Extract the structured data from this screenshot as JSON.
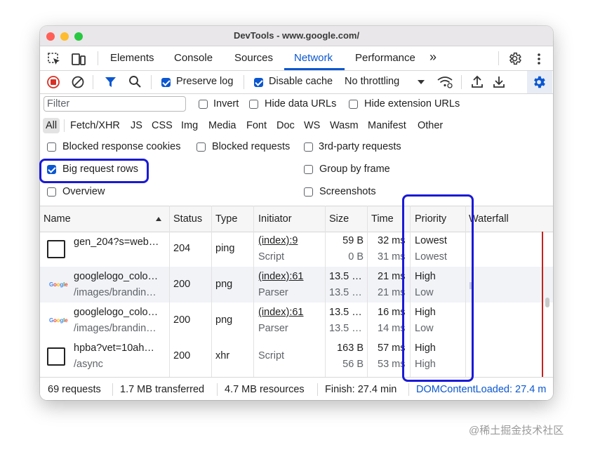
{
  "window": {
    "title": "DevTools - www.google.com/"
  },
  "tabs": [
    "Elements",
    "Console",
    "Sources",
    "Network",
    "Performance"
  ],
  "toolbar": {
    "preserve_log": "Preserve log",
    "disable_cache": "Disable cache",
    "throttling": "No throttling"
  },
  "filter": {
    "placeholder": "Filter",
    "invert": "Invert",
    "hide_data_urls": "Hide data URLs",
    "hide_extension_urls": "Hide extension URLs"
  },
  "type_filters": [
    "All",
    "Fetch/XHR",
    "JS",
    "CSS",
    "Img",
    "Media",
    "Font",
    "Doc",
    "WS",
    "Wasm",
    "Manifest",
    "Other"
  ],
  "options": {
    "blocked_response_cookies": "Blocked response cookies",
    "blocked_requests": "Blocked requests",
    "third_party_requests": "3rd-party requests",
    "big_request_rows": "Big request rows",
    "group_by_frame": "Group by frame",
    "overview": "Overview",
    "screenshots": "Screenshots"
  },
  "columns": {
    "name": "Name",
    "status": "Status",
    "type": "Type",
    "initiator": "Initiator",
    "size": "Size",
    "time": "Time",
    "priority": "Priority",
    "waterfall": "Waterfall"
  },
  "requests": [
    {
      "name": "gen_204?s=web…",
      "path": "",
      "status": "204",
      "type": "ping",
      "initiator": "(index):9",
      "initiator_sub": "Script",
      "size": "59 B",
      "size_sub": "0 B",
      "time": "32 ms",
      "time_sub": "31 ms",
      "priority": "Lowest",
      "priority_sub": "Lowest"
    },
    {
      "name": "googlelogo_colo…",
      "path": "/images/brandin…",
      "status": "200",
      "type": "png",
      "initiator": "(index):61",
      "initiator_sub": "Parser",
      "size": "13.5 …",
      "size_sub": "13.5 …",
      "time": "21 ms",
      "time_sub": "21 ms",
      "priority": "High",
      "priority_sub": "Low"
    },
    {
      "name": "googlelogo_colo…",
      "path": "/images/brandin…",
      "status": "200",
      "type": "png",
      "initiator": "(index):61",
      "initiator_sub": "Parser",
      "size": "13.5 …",
      "size_sub": "13.5 …",
      "time": "16 ms",
      "time_sub": "14 ms",
      "priority": "High",
      "priority_sub": "Low"
    },
    {
      "name": "hpba?vet=10ah…",
      "path": "/async",
      "status": "200",
      "type": "xhr",
      "initiator": "",
      "initiator_sub": "Script",
      "size": "163 B",
      "size_sub": "56 B",
      "time": "57 ms",
      "time_sub": "53 ms",
      "priority": "High",
      "priority_sub": "High"
    }
  ],
  "logo_text": "Google",
  "status": {
    "requests": "69 requests",
    "transferred": "1.7 MB transferred",
    "resources": "4.7 MB resources",
    "finish": "Finish: 27.4 min",
    "dom": "DOMContentLoaded: 27.4 m"
  },
  "watermark": "@稀土掘金技术社区",
  "colors": {
    "accent": "#0b57d0",
    "highlight": "#1a1ad6",
    "record": "#d93025"
  }
}
